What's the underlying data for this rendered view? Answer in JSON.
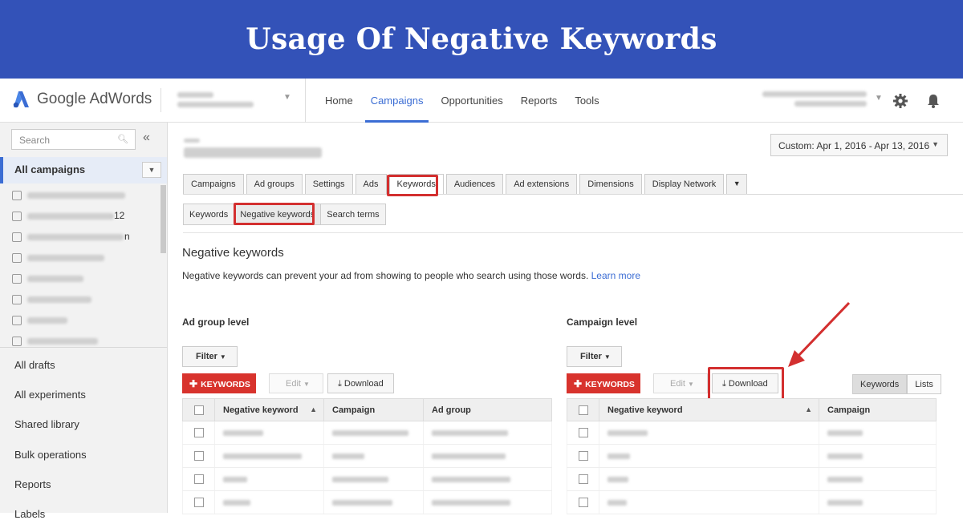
{
  "banner": {
    "title": "Usage Of Negative Keywords"
  },
  "app": {
    "logo_text": "Google AdWords",
    "nav": [
      "Home",
      "Campaigns",
      "Opportunities",
      "Reports",
      "Tools"
    ],
    "active_nav": "Campaigns"
  },
  "sidebar": {
    "search_placeholder": "Search",
    "collapse_glyph": "«",
    "all_campaigns": "All campaigns",
    "campaign_tails": {
      "c2": "12",
      "c3": "n"
    },
    "links": [
      "All drafts",
      "All experiments",
      "Shared library",
      "Bulk operations",
      "Reports",
      "Labels"
    ]
  },
  "main": {
    "date_range": "Custom: Apr 1, 2016 - Apr 13, 2016",
    "tabs": [
      "Campaigns",
      "Ad groups",
      "Settings",
      "Ads",
      "Keywords",
      "Audiences",
      "Ad extensions",
      "Dimensions",
      "Display Network"
    ],
    "active_tab": "Keywords",
    "subtabs": [
      "Keywords",
      "Negative keywords",
      "Search terms"
    ],
    "active_subtab": "Negative keywords",
    "section_title": "Negative keywords",
    "section_desc": "Negative keywords can prevent your ad from showing to people who search using those words.",
    "learn_more": "Learn more",
    "ad_group_level": {
      "title": "Ad group level",
      "filter": "Filter",
      "add_keywords": "KEYWORDS",
      "edit": "Edit",
      "download": "Download",
      "columns": [
        "Negative keyword",
        "Campaign",
        "Ad group"
      ]
    },
    "campaign_level": {
      "title": "Campaign level",
      "filter": "Filter",
      "add_keywords": "KEYWORDS",
      "edit": "Edit",
      "download": "Download",
      "view_toggle": [
        "Keywords",
        "Lists"
      ],
      "view_selected": "Keywords",
      "columns": [
        "Negative keyword",
        "Campaign"
      ]
    }
  },
  "colors": {
    "banner_bg": "#3352b8",
    "accent": "#3b6dd4",
    "highlight": "#d32f2f",
    "keyword_button": "#d8332d"
  }
}
